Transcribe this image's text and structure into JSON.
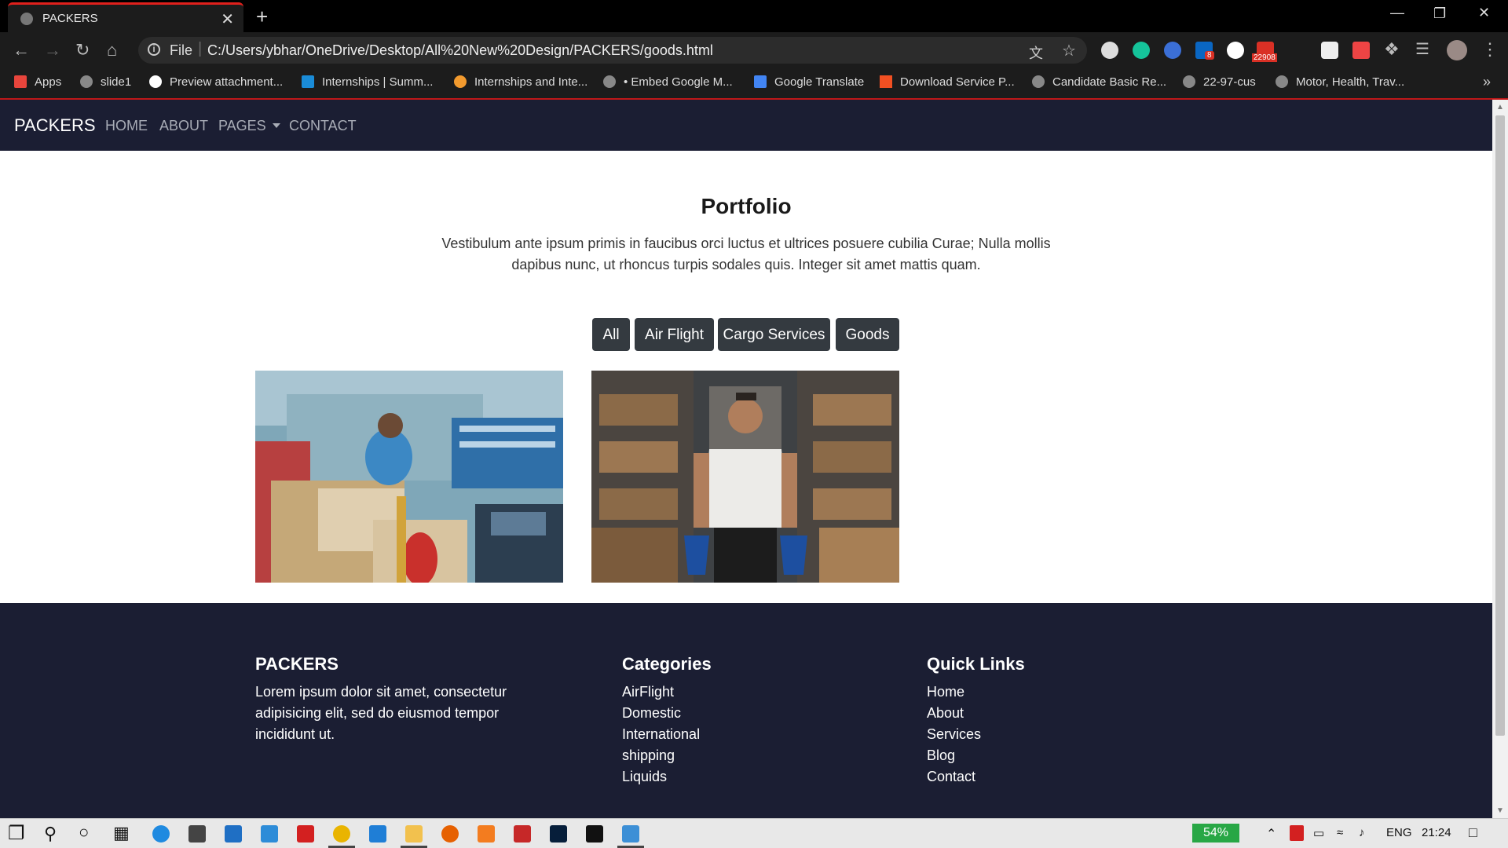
{
  "browser": {
    "tab_title": "PACKERS",
    "tab_close": "✕",
    "new_tab": "+",
    "scheme_label": "File",
    "url": "C:/Users/ybhar/OneDrive/Desktop/All%20New%20Design/PACKERS/goods.html",
    "ext_badges": {
      "linkedin": "8",
      "mail": "22908"
    },
    "bookmarks": [
      "Apps",
      "slide1",
      "Preview attachment...",
      "Internships | Summ...",
      "Internships and Inte...",
      "• Embed Google M...",
      "Google Translate",
      "Download Service P...",
      "Candidate Basic Re...",
      "22-97-cus",
      "Motor, Health, Trav..."
    ],
    "bookmarks_more": "»"
  },
  "nav": {
    "brand": "PACKERS",
    "links": [
      "HOME",
      "ABOUT",
      "PAGES",
      "CONTACT"
    ]
  },
  "portfolio": {
    "title": "Portfolio",
    "description": "Vestibulum ante ipsum primis in faucibus orci luctus et ultrices posuere cubilia Curae; Nulla mollis dapibus nunc, ut rhoncus turpis sodales quis. Integer sit amet mattis quam.",
    "filters": [
      "All",
      "Air Flight",
      "Cargo Services",
      "Goods"
    ],
    "images": [
      {
        "name": "workers-loading-boxes"
      },
      {
        "name": "man-in-warehouse"
      }
    ]
  },
  "footer": {
    "col1": {
      "title": "PACKERS",
      "text": "Lorem ipsum dolor sit amet, consectetur adipisicing elit, sed do eiusmod tempor incididunt ut."
    },
    "col2": {
      "title": "Categories",
      "items": [
        "AirFlight",
        "Domestic",
        "International",
        "shipping",
        "Liquids"
      ]
    },
    "col3": {
      "title": "Quick Links",
      "items": [
        "Home",
        "About",
        "Services",
        "Blog",
        "Contact"
      ]
    }
  },
  "taskbar": {
    "battery": "54%",
    "language": "ENG",
    "time": "21:24"
  }
}
